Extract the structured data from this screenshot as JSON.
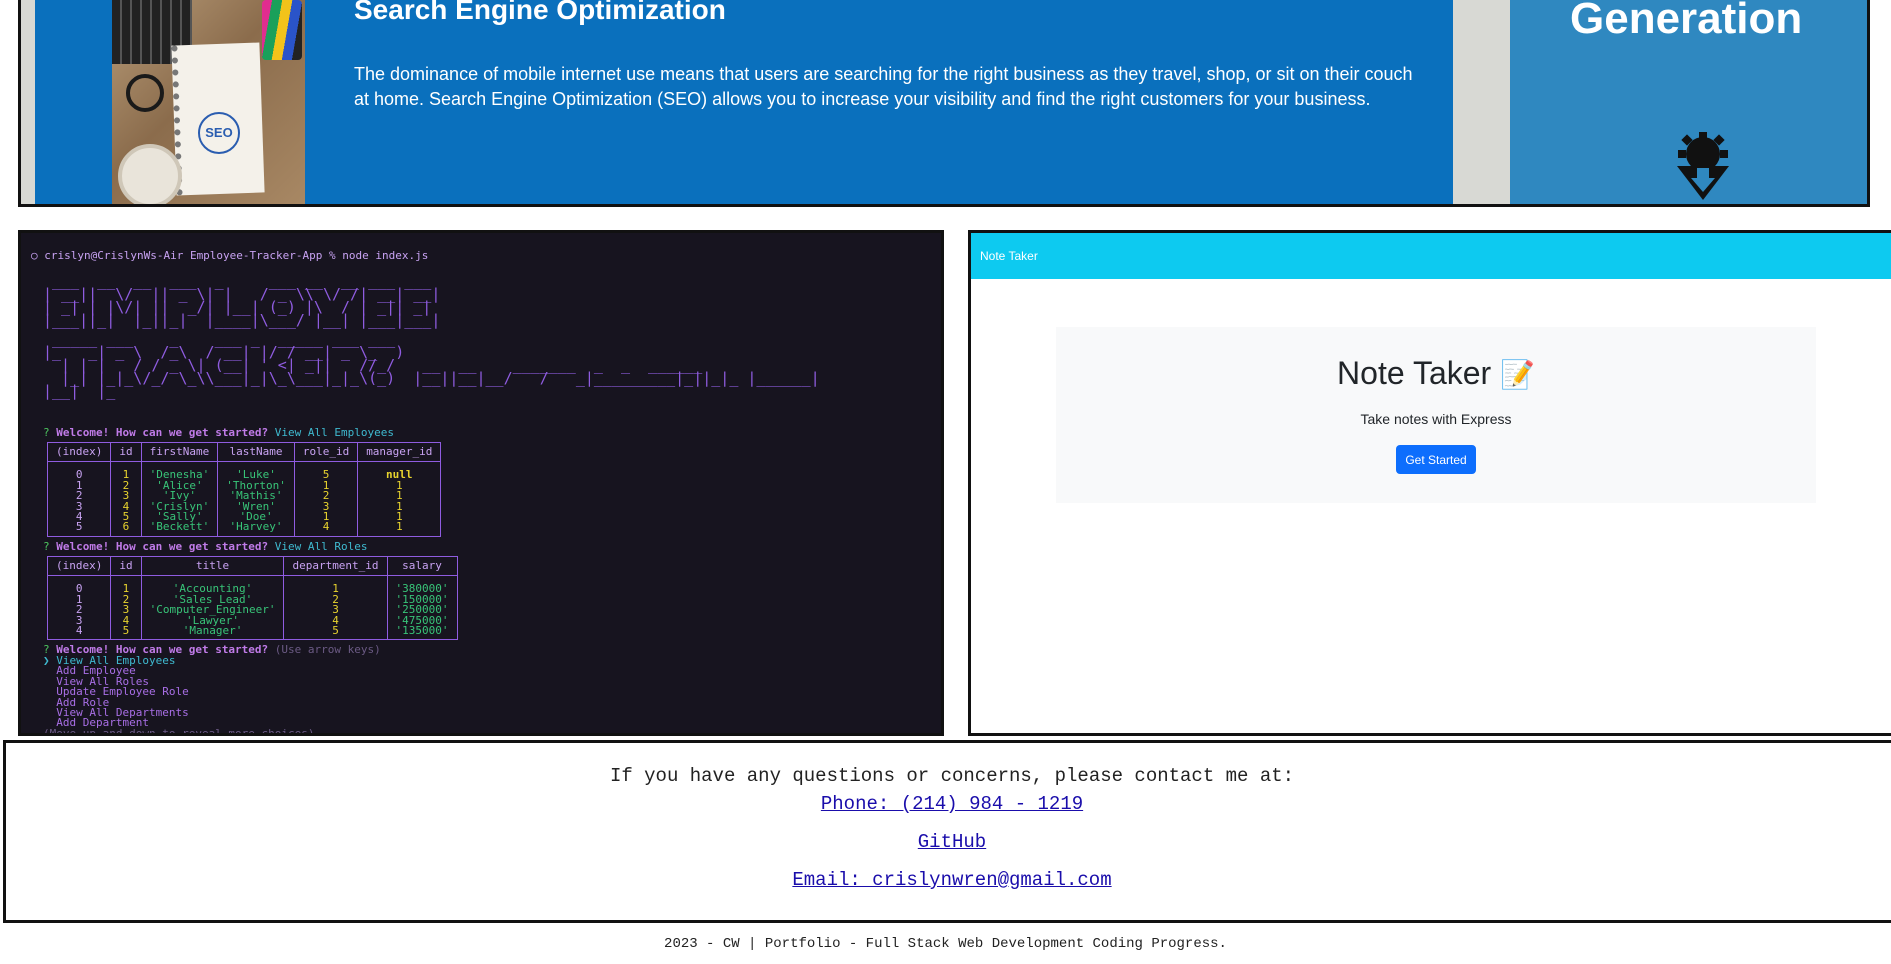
{
  "banner": {
    "seo_title": "Search Engine Optimization",
    "seo_text": "The dominance of mobile internet use means that users are searching for the right business as they travel, shop, or sit on their couch at home. Search Engine Optimization (SEO) allows you to increase your visibility and find the right customers for your business.",
    "right_title": "Generation",
    "photo_badge": "SEO",
    "icon": "gear-download-icon",
    "colors": {
      "blue": "#0a70bd",
      "right_panel": "#2f88c0"
    }
  },
  "terminal": {
    "prompt": "○ crislyn@CrislynWs-Air Employee-Tracker-App % node index.js",
    "ascii_line1": " ___  __  __  ___  _     ___ __  __ ___ ___\n| __||  \\/  || _ \\| |   / _ \\\\ \\/ /| __| __|\n| _| | |\\/| ||  _/| |__| (_) |\\  / | _|| _|\n|___||_|  |_||_|  |____|\\___/ |__| |___|___|",
    "ascii_line2": " _____ ___    _    ___ _  _____ ___ ___\n|_   _| _ \\  /_\\  / __| |/ / __| _ \\_  )\n  | | |   / / _ \\| (__| ' <| _||   //_/   __  __    _______  _  _  ______\n  |_| |_|_\\/_/ \\_\\\\___|_|\\_\\___|_|_\\(_)  |__||__|__/   /   _|_________|_||_|_ |______|\n|__|  |_",
    "q_mark": "?",
    "welcome": "Welcome! How can we get started?",
    "answer1": "View All Employees",
    "answer2": "View All Roles",
    "hint": "(Use arrow keys)",
    "employees": {
      "headers": [
        "(index)",
        "id",
        "firstName",
        "lastName",
        "role_id",
        "manager_id"
      ],
      "rows": [
        [
          "0",
          "1",
          "'Denesha'",
          "'Luke'",
          "5",
          "null"
        ],
        [
          "1",
          "2",
          "'Alice'",
          "'Thorton'",
          "1",
          "1"
        ],
        [
          "2",
          "3",
          "'Ivy'",
          "'Mathis'",
          "2",
          "1"
        ],
        [
          "3",
          "4",
          "'Crislyn'",
          "'Wren'",
          "3",
          "1"
        ],
        [
          "4",
          "5",
          "'Sally'",
          "'Doe'",
          "1",
          "1"
        ],
        [
          "5",
          "6",
          "'Beckett'",
          "'Harvey'",
          "4",
          "1"
        ]
      ]
    },
    "roles": {
      "headers": [
        "(index)",
        "id",
        "title",
        "department_id",
        "salary"
      ],
      "rows": [
        [
          "0",
          "1",
          "'Accounting'",
          "1",
          "'380000'"
        ],
        [
          "1",
          "2",
          "'Sales Lead'",
          "2",
          "'150000'"
        ],
        [
          "2",
          "3",
          "'Computer_Engineer'",
          "3",
          "'250000'"
        ],
        [
          "3",
          "4",
          "'Lawyer'",
          "4",
          "'475000'"
        ],
        [
          "4",
          "5",
          "'Manager'",
          "5",
          "'135000'"
        ]
      ]
    },
    "menu": {
      "pointer": "❯",
      "items": [
        "View All Employees",
        "Add Employee",
        "View All Roles",
        "Update Employee Role",
        "Add Role",
        "View All Departments",
        "Add Department"
      ],
      "footer": "(Move up and down to reveal more choices)"
    }
  },
  "note_taker": {
    "brand": "Note Taker",
    "title": "Note Taker",
    "title_icon": "memo-icon",
    "subtitle": "Take notes with Express",
    "button": "Get Started",
    "colors": {
      "nav": "#0dcaf0",
      "button": "#0d6efd"
    }
  },
  "contact": {
    "intro": "If you have any questions or concerns, please contact me at:",
    "phone": "Phone: (214) 984 - 1219",
    "github": "GitHub",
    "email": "Email: crislynwren@gmail.com"
  },
  "footer": "2023 - CW | Portfolio - Full Stack Web Development Coding Progress."
}
